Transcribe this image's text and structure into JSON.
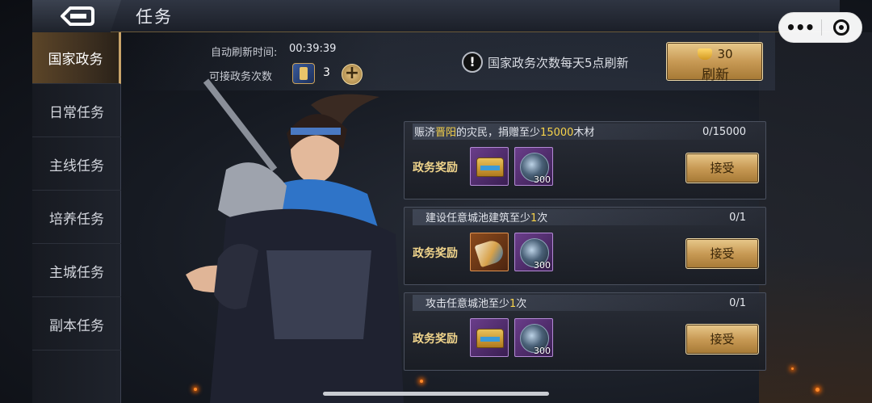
{
  "header": {
    "title": "任务",
    "auto_refresh_label": "自动刷新时间:",
    "auto_refresh_time": "00:39:39",
    "available_label": "可接政务次数",
    "available_count": "3",
    "notice": "国家政务次数每天5点刷新",
    "refresh_cost": "30",
    "refresh_label": "刷新"
  },
  "mini_program": {
    "more_glyph": "•••"
  },
  "sidebar": {
    "items": [
      {
        "label": "国家政务",
        "active": true
      },
      {
        "label": "日常任务"
      },
      {
        "label": "主线任务"
      },
      {
        "label": "培养任务"
      },
      {
        "label": "主城任务"
      },
      {
        "label": "副本任务"
      }
    ]
  },
  "tasks": [
    {
      "text_pre": "赈济",
      "text_hl1": "晋阳",
      "text_mid": "的灾民，捐赠至少",
      "text_hl2": "15000",
      "text_post": "木材",
      "progress": "0/15000",
      "reward_label": "政务奖励",
      "rewards": [
        {
          "icon": "treasure-chest-icon"
        },
        {
          "icon": "merit-orb-icon",
          "qty": "300"
        }
      ],
      "button": "接受"
    },
    {
      "text_pre": "建设任意城池建筑至少",
      "text_hl1": "1",
      "text_post": "次",
      "progress": "0/1",
      "reward_label": "政务奖励",
      "rewards": [
        {
          "icon": "war-horn-icon"
        },
        {
          "icon": "merit-orb-icon",
          "qty": "300"
        }
      ],
      "button": "接受"
    },
    {
      "text_pre": "攻击任意城池至少",
      "text_hl1": "1",
      "text_post": "次",
      "progress": "0/1",
      "reward_label": "政务奖励",
      "rewards": [
        {
          "icon": "treasure-chest-icon"
        },
        {
          "icon": "merit-orb-icon",
          "qty": "300"
        }
      ],
      "button": "接受"
    }
  ],
  "colors": {
    "accent_gold": "#c89a55",
    "highlight_yellow": "#f7d34a",
    "panel_dark": "#1b1f28"
  }
}
